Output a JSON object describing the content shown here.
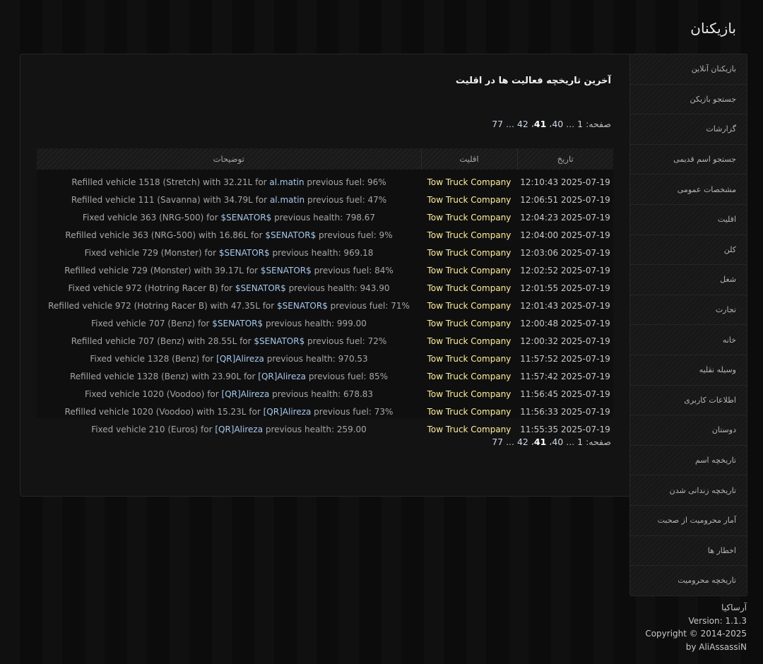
{
  "page_title": "بازیکنان",
  "panel": {
    "heading": "آخرین تاریخچه فعالیت ها در اقلیت",
    "pager": {
      "label": "صفحه:",
      "pages": [
        "1",
        "...",
        "40",
        "41",
        "42",
        "...",
        "77"
      ],
      "current": "41"
    },
    "table": {
      "headers": [
        "تاریخ",
        "اقلیت",
        "توضیحات"
      ],
      "rows": [
        {
          "date": "2025-07-19 12:10:43",
          "faction": "Tow Truck Company",
          "pre": "Refilled vehicle 1518 (Stretch) with 32.21L for ",
          "player": "al.matin",
          "post": " previous fuel: 96%"
        },
        {
          "date": "2025-07-19 12:06:51",
          "faction": "Tow Truck Company",
          "pre": "Refilled vehicle 111 (Savanna) with 34.79L for ",
          "player": "al.matin",
          "post": " previous fuel: 47%"
        },
        {
          "date": "2025-07-19 12:04:23",
          "faction": "Tow Truck Company",
          "pre": "Fixed vehicle 363 (NRG-500) for ",
          "player": "$SENATOR$",
          "post": " previous health: 798.67"
        },
        {
          "date": "2025-07-19 12:04:00",
          "faction": "Tow Truck Company",
          "pre": "Refilled vehicle 363 (NRG-500) with 16.86L for ",
          "player": "$SENATOR$",
          "post": " previous fuel: 9%"
        },
        {
          "date": "2025-07-19 12:03:06",
          "faction": "Tow Truck Company",
          "pre": "Fixed vehicle 729 (Monster) for ",
          "player": "$SENATOR$",
          "post": " previous health: 969.18"
        },
        {
          "date": "2025-07-19 12:02:52",
          "faction": "Tow Truck Company",
          "pre": "Refilled vehicle 729 (Monster) with 39.17L for ",
          "player": "$SENATOR$",
          "post": " previous fuel: 84%"
        },
        {
          "date": "2025-07-19 12:01:55",
          "faction": "Tow Truck Company",
          "pre": "Fixed vehicle 972 (Hotring Racer B) for ",
          "player": "$SENATOR$",
          "post": " previous health: 943.90"
        },
        {
          "date": "2025-07-19 12:01:43",
          "faction": "Tow Truck Company",
          "pre": "Refilled vehicle 972 (Hotring Racer B) with 47.35L for ",
          "player": "$SENATOR$",
          "post": " previous fuel: 71%"
        },
        {
          "date": "2025-07-19 12:00:48",
          "faction": "Tow Truck Company",
          "pre": "Fixed vehicle 707 (Benz) for ",
          "player": "$SENATOR$",
          "post": " previous health: 999.00"
        },
        {
          "date": "2025-07-19 12:00:32",
          "faction": "Tow Truck Company",
          "pre": "Refilled vehicle 707 (Benz) with 28.55L for ",
          "player": "$SENATOR$",
          "post": " previous fuel: 72%"
        },
        {
          "date": "2025-07-19 11:57:52",
          "faction": "Tow Truck Company",
          "pre": "Fixed vehicle 1328 (Benz) for ",
          "player": "[QR]Alireza",
          "post": " previous health: 970.53"
        },
        {
          "date": "2025-07-19 11:57:42",
          "faction": "Tow Truck Company",
          "pre": "Refilled vehicle 1328 (Benz) with 23.90L for ",
          "player": "[QR]Alireza",
          "post": " previous fuel: 85%"
        },
        {
          "date": "2025-07-19 11:56:45",
          "faction": "Tow Truck Company",
          "pre": "Fixed vehicle 1020 (Voodoo) for ",
          "player": "[QR]Alireza",
          "post": " previous health: 678.83"
        },
        {
          "date": "2025-07-19 11:56:33",
          "faction": "Tow Truck Company",
          "pre": "Refilled vehicle 1020 (Voodoo) with 15.23L for ",
          "player": "[QR]Alireza",
          "post": " previous fuel: 73%"
        },
        {
          "date": "2025-07-19 11:55:35",
          "faction": "Tow Truck Company",
          "pre": "Fixed vehicle 210 (Euros) for ",
          "player": "[QR]Alireza",
          "post": " previous health: 259.00"
        }
      ]
    }
  },
  "sidebar": {
    "items": [
      "بازیکنان آنلاین",
      "جستجو بازیکن",
      "گزارشات",
      "جستجو اسم قدیمی",
      "مشخصات عمومی",
      "اقلیت",
      "کلن",
      "شغل",
      "تجارت",
      "خانه",
      "وسیله نقلیه",
      "اطلاعات کاربری",
      "دوستان",
      "تاریخچه اسم",
      "تاریخچه زندانی شدن",
      "آمار محرومیت از صحبت",
      "اخطار ها",
      "تاریخچه محرومیت"
    ]
  },
  "footer": {
    "site": "آرساکیا",
    "version": "Version: 1.1.3",
    "copyright": "Copyright © 2014-2025",
    "author": "by AliAssassiN"
  },
  "colors": {
    "background": "#0d0d0e",
    "faction": "#ffef9a",
    "player_link": "#a6c8ea"
  }
}
